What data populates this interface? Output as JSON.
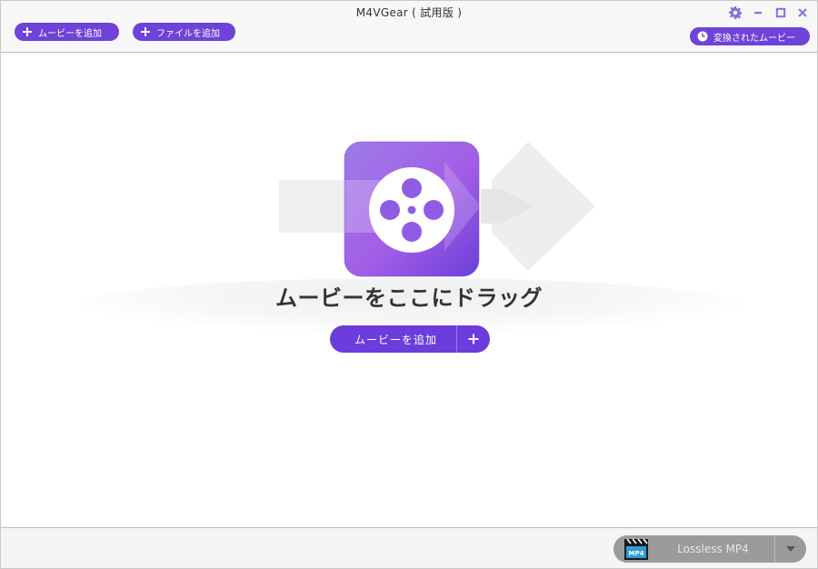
{
  "app": {
    "title": "M4VGear ( 試用版 )"
  },
  "toolbar": {
    "add_movie_label": "ムービーを追加",
    "add_file_label": "ファイルを追加",
    "converted_label": "変換されたムービー"
  },
  "main": {
    "drop_text": "ムービーをここにドラッグ",
    "add_movie_button": "ムービーを追加"
  },
  "output": {
    "format_label": "Lossless MP4",
    "format_icon_text": "MP4"
  },
  "colors": {
    "accent": "#6a3ddc",
    "toolbar_bg": "#f7f7f7",
    "format_bg": "#9b9b9b"
  }
}
